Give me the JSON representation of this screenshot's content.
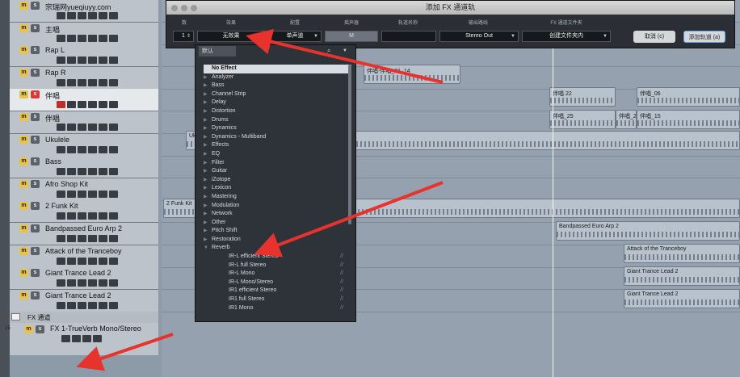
{
  "tracks": [
    {
      "name": "宗瑞网yueqiuyy.com",
      "num": "",
      "solo_on": false,
      "rec": false
    },
    {
      "name": "主唱",
      "num": "",
      "solo_on": false,
      "rec": false
    },
    {
      "name": "Rap L",
      "num": "",
      "solo_on": false,
      "rec": false
    },
    {
      "name": "Rap R",
      "num": "",
      "solo_on": false,
      "rec": false
    },
    {
      "name": "伴唱",
      "num": "",
      "solo_on": true,
      "rec": true
    },
    {
      "name": "伴唱",
      "num": "",
      "solo_on": false,
      "rec": false
    },
    {
      "name": "Ukulele",
      "num": "",
      "solo_on": false,
      "rec": false
    },
    {
      "name": "Bass",
      "num": "",
      "solo_on": false,
      "rec": false
    },
    {
      "name": "Afro Shop Kit",
      "num": "",
      "solo_on": false,
      "rec": false
    },
    {
      "name": "2 Funk Kit",
      "num": "",
      "solo_on": false,
      "rec": false
    },
    {
      "name": "Bandpassed Euro Arp 2",
      "num": "",
      "solo_on": false,
      "rec": false
    },
    {
      "name": "Attack of the Tranceboy",
      "num": "",
      "solo_on": false,
      "rec": false
    },
    {
      "name": "Giant Trance Lead 2",
      "num": "",
      "solo_on": false,
      "rec": false
    },
    {
      "name": "Giant Trance Lead 2",
      "num": "",
      "solo_on": false,
      "rec": false
    }
  ],
  "fx_folder": {
    "label": "FX 通道",
    "track_name": "FX 1-TrueVerb Mono/Stereo",
    "num": "15"
  },
  "dialog": {
    "title": "添加 FX 通道轨",
    "headers": {
      "count": "数",
      "effect": "效果",
      "config": "配置",
      "panner": "摇声器",
      "track_name": "轨道名称",
      "output": "输出路线",
      "folder": "FX 通道文件夹"
    },
    "count_value": "1",
    "effect_value": "无效果",
    "config_value": "单声道",
    "panner_value": "M",
    "track_name_value": "",
    "output_value": "Stereo Out",
    "folder_value": "创建文件夹内",
    "cancel_label": "取消 (c)",
    "add_label": "添加轨道 (a)"
  },
  "popup": {
    "tab_label": "默认",
    "items": [
      {
        "label": "No Effect",
        "type": "selected"
      },
      {
        "label": "Analyzer",
        "type": "folder"
      },
      {
        "label": "Bass",
        "type": "folder"
      },
      {
        "label": "Channel Strip",
        "type": "folder"
      },
      {
        "label": "Delay",
        "type": "folder"
      },
      {
        "label": "Distortion",
        "type": "folder"
      },
      {
        "label": "Drums",
        "type": "folder"
      },
      {
        "label": "Dynamics",
        "type": "folder"
      },
      {
        "label": "Dynamics - Multiband",
        "type": "folder"
      },
      {
        "label": "Effects",
        "type": "folder"
      },
      {
        "label": "EQ",
        "type": "folder"
      },
      {
        "label": "Filter",
        "type": "folder"
      },
      {
        "label": "Guitar",
        "type": "folder"
      },
      {
        "label": "iZotope",
        "type": "folder"
      },
      {
        "label": "Lexicon",
        "type": "folder"
      },
      {
        "label": "Mastering",
        "type": "folder"
      },
      {
        "label": "Modulation",
        "type": "folder"
      },
      {
        "label": "Network",
        "type": "folder"
      },
      {
        "label": "Other",
        "type": "folder"
      },
      {
        "label": "Pitch Shift",
        "type": "folder"
      },
      {
        "label": "Restoration",
        "type": "folder"
      },
      {
        "label": "Reverb",
        "type": "open"
      },
      {
        "label": "IR-L efficient Stereo",
        "type": "sub",
        "channels": "//"
      },
      {
        "label": "IR-L full Stereo",
        "type": "sub",
        "channels": "//"
      },
      {
        "label": "IR-L Mono",
        "type": "sub",
        "channels": "//"
      },
      {
        "label": "IR-L Mono/Stereo",
        "type": "sub",
        "channels": "//"
      },
      {
        "label": "IR1 efficient Stereo",
        "type": "sub",
        "channels": "//"
      },
      {
        "label": "IR1 full Stereo",
        "type": "sub",
        "channels": "//"
      },
      {
        "label": "IR1 Mono",
        "type": "sub",
        "channels": "//"
      }
    ]
  },
  "clips": {
    "c1": "伴唱 22",
    "c2": "伴唱_06",
    "c3": "伴唱_25",
    "c4": "伴唱_2",
    "c5": "伴唱_15",
    "c6": "伴唱-伴唱_01_14",
    "c7": "2 Funk Kit",
    "c8": "Bandpassed Euro Arp 2",
    "c9": "Attack of the Tranceboy",
    "c10": "Giant Trance Lead 2",
    "c11": "Giant Trance Lead 2",
    "c12": "Ukulele"
  },
  "colors": {
    "accent_red": "#e8322d",
    "mute_yellow": "#e8c24a",
    "solo_red": "#d83a3a"
  }
}
